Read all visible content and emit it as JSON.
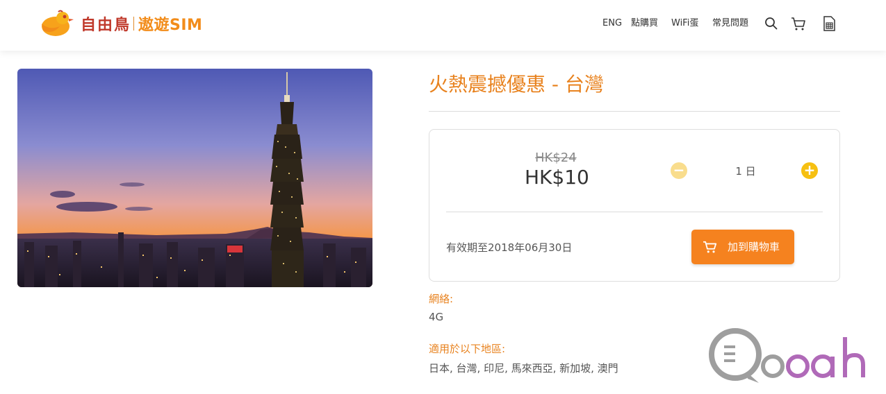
{
  "header": {
    "logo": {
      "cn": "自由鳥",
      "en": "遨遊SIM"
    },
    "nav": {
      "lang": "ENG",
      "buy": "點購買",
      "wifi": "WiFi蛋",
      "faq": "常見問題"
    },
    "icons": [
      "search-icon",
      "cart-icon",
      "sim-card-icon"
    ]
  },
  "hero": {
    "alt": "Taipei skyline at sunset"
  },
  "product": {
    "title": "火熱震撼優惠 - 台灣",
    "original_price": "HK$24",
    "price": "HK$10",
    "quantity": "1 日",
    "validity": "有效期至2018年06月30日",
    "add_to_cart": "加到購物車",
    "network_label": "網絡:",
    "network_value": "4G",
    "regions_label": "適用於以下地區:",
    "regions_value": "日本, 台灣, 印尼, 馬來西亞, 新加坡, 澳門"
  },
  "watermark": {
    "text": "Qooah"
  },
  "colors": {
    "accent": "#f5821f",
    "title": "#e8821e",
    "qty_plus": "#f6c012",
    "qty_minus": "#f9dd8d",
    "logo_red": "#c0392b"
  }
}
